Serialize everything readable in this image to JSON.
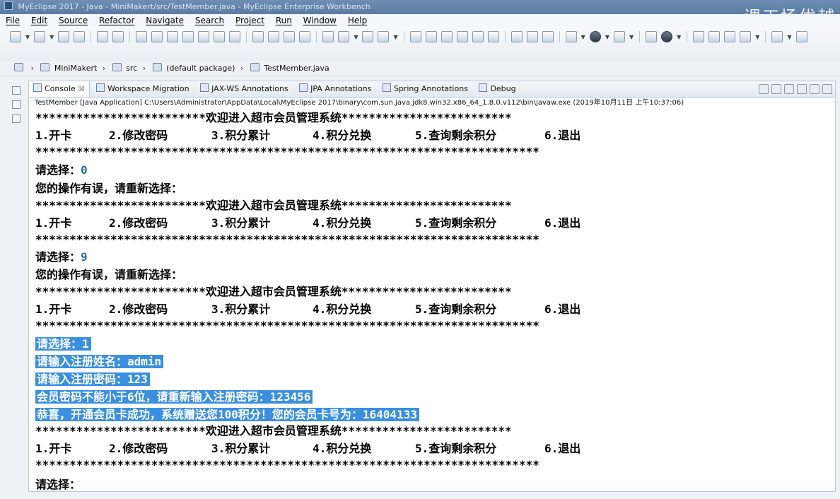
{
  "window": {
    "title": "MyEclipse 2017 - Java - MiniMakert/src/TestMember.java - MyEclipse Enterprise Workbench",
    "watermark": "课工场优越"
  },
  "menubar": [
    "File",
    "Edit",
    "Source",
    "Refactor",
    "Navigate",
    "Search",
    "Project",
    "Run",
    "Window",
    "Help"
  ],
  "breadcrumb": {
    "project": "MiniMakert",
    "folder": "src",
    "package": "(default package)",
    "file": "TestMember.java"
  },
  "tabs": [
    {
      "label": "Console",
      "close": "☒",
      "active": true
    },
    {
      "label": "Workspace Migration"
    },
    {
      "label": "JAX-WS Annotations"
    },
    {
      "label": "JPA Annotations"
    },
    {
      "label": "Spring Annotations"
    },
    {
      "label": "Debug"
    }
  ],
  "console": {
    "launch_info": "TestMember [Java Application] C:\\Users\\Administrator\\AppData\\Local\\MyEclipse 2017\\binary\\com.sun.java.jdk8.win32.x86_64_1.8.0.v112\\bin\\javaw.exe (2019年10月11日 上午10:37:06)",
    "header_line": "*************************欢迎进入超市会员管理系统*************************",
    "star_line": "**************************************************************************",
    "menu": [
      "1.开卡",
      "2.修改密码",
      "3.积分累计",
      "4.积分兑换",
      "5.查询剩余积分",
      "6.退出"
    ],
    "prompt": "请选择：",
    "error": "您的操作有误，请重新选择：",
    "inputs": [
      "0",
      "9",
      "1"
    ],
    "selected_lines": {
      "choose": "请选择：1",
      "name": "请输入注册姓名：admin",
      "pwd": "请输入注册密码：123",
      "pwd_retry": "会员密码不能小于6位，请重新输入注册密码：123456",
      "success": "恭喜，开通会员卡成功，系统赠送您100积分！您的会员卡号为：16404133"
    }
  },
  "colors": {
    "selection": "#3a8fe0",
    "input_value": "#2a6fb0"
  }
}
